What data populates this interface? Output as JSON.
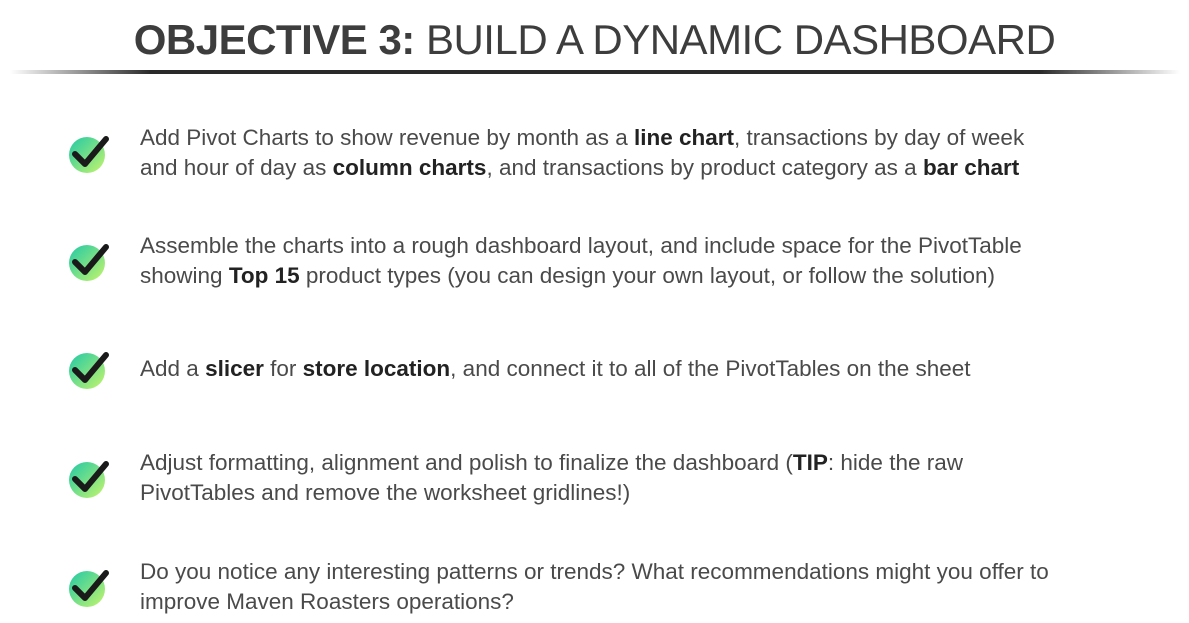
{
  "header": {
    "title_bold": "OBJECTIVE 3:",
    "title_rest": " BUILD A DYNAMIC DASHBOARD"
  },
  "icons": {
    "check": "check-icon",
    "check_color": "#1a1a1a",
    "badge_gradient": [
      "#20c9a6",
      "#c6f56b"
    ]
  },
  "objectives": [
    {
      "segments": [
        {
          "t": "Add Pivot Charts to show revenue by month as a "
        },
        {
          "t": "line chart",
          "b": true
        },
        {
          "t": ", transactions by day of week"
        },
        {
          "t": "\n"
        },
        {
          "t": "and hour of day as "
        },
        {
          "t": "column charts",
          "b": true
        },
        {
          "t": ", and transactions by product category as a "
        },
        {
          "t": "bar chart",
          "b": true
        }
      ]
    },
    {
      "segments": [
        {
          "t": "Assemble the charts into a rough dashboard layout, and include space for the PivotTable"
        },
        {
          "t": "\n"
        },
        {
          "t": "showing "
        },
        {
          "t": "Top 15",
          "b": true
        },
        {
          "t": " product types (you can design your own layout, or follow the solution)"
        }
      ]
    },
    {
      "segments": [
        {
          "t": "Add a "
        },
        {
          "t": "slicer",
          "b": true
        },
        {
          "t": " for "
        },
        {
          "t": "store location",
          "b": true
        },
        {
          "t": ", and connect it to all of the PivotTables on the sheet"
        }
      ]
    },
    {
      "segments": [
        {
          "t": "Adjust formatting, alignment and polish to finalize the dashboard ("
        },
        {
          "t": "TIP",
          "b": true
        },
        {
          "t": ": hide the raw"
        },
        {
          "t": "\n"
        },
        {
          "t": "PivotTables and remove the worksheet gridlines!)"
        }
      ]
    },
    {
      "segments": [
        {
          "t": "Do you notice any interesting patterns or trends? What recommendations might you offer to"
        },
        {
          "t": "\n"
        },
        {
          "t": "improve Maven Roasters operations?"
        }
      ]
    }
  ]
}
